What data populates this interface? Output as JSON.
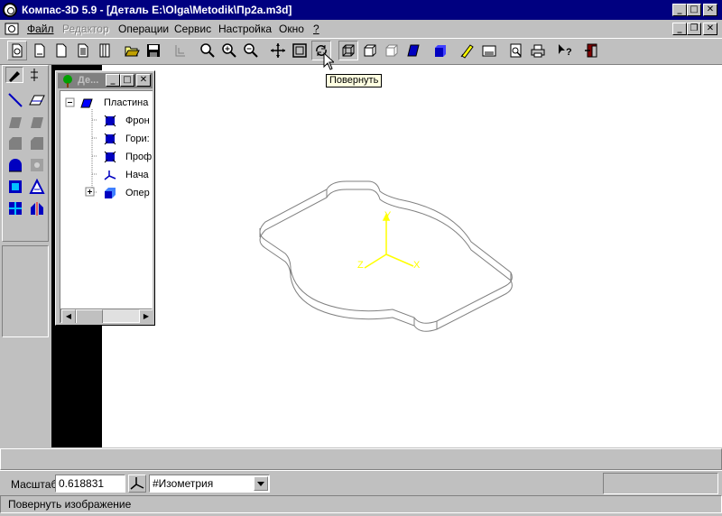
{
  "window": {
    "title": "Компас-3D 5.9 - [Деталь E:\\Olga\\Metodik\\Пр2а.m3d]"
  },
  "menu": {
    "items": [
      "Файл",
      "Редактор",
      "Операции",
      "Сервис",
      "Настройка",
      "Окно",
      "?"
    ],
    "disabled": [
      "Редактор"
    ]
  },
  "tooltip": "Повернуть",
  "tree": {
    "title": "Де...",
    "root": "Пластина",
    "items": [
      "Фрон",
      "Гори:",
      "Проф",
      "Нача",
      "Опер"
    ]
  },
  "scale": {
    "label": "Масштаб",
    "value": "0.618831",
    "orientation": "#Изометрия"
  },
  "status": "Повернуть изображение",
  "axes": {
    "x": "X",
    "y": "Y",
    "z": "Z"
  },
  "colors": {
    "titlebar": "#000080",
    "axes": "#ffff00",
    "part_edges": "#808080",
    "tree_icon": "#0000ff"
  },
  "toolbar_icons": [
    "new-document-icon",
    "new-sheet-icon",
    "new-text-icon",
    "new-spec-icon",
    "open-folder-icon",
    "save-disk-icon",
    "insert-fragment-icon",
    "zoom-window-icon",
    "zoom-in-icon",
    "zoom-out-icon",
    "pan-icon",
    "zoom-all-icon",
    "rotate-icon",
    "wireframe-icon",
    "hidden-lines-icon",
    "no-hidden-lines-icon",
    "shaded-icon",
    "perspective-icon",
    "edit-part-icon",
    "properties-icon",
    "print-preview-icon",
    "print-icon",
    "help-icon",
    "exit-icon"
  ]
}
